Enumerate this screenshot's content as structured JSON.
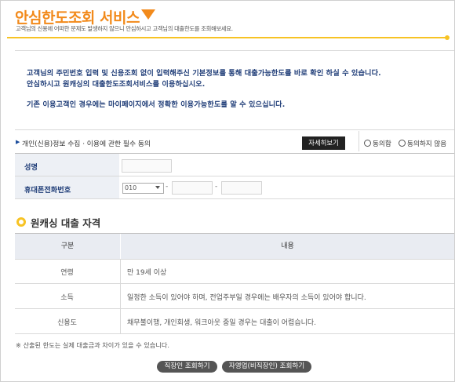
{
  "header": {
    "title": "안심한도조회 서비스",
    "subtitle": "고객님의 신용에 어떠한 문제도 발생하지 않으니 안심하시고 고객님의 대출한도를 조회해보세요."
  },
  "notice": {
    "line1": "고객님의 주민번호 입력 및 신용조회 없이 입력해주신 기본정보를 통해 대출가능한도를 바로 확인 하실 수 있습니다.",
    "line2": "안심하시고 원캐싱의 대출한도조회서비스를 이용하십시오.",
    "line3": "기존 이용고객인 경우에는 마이페이지에서 정확한 이용가능한도를 알 수 있으십니다."
  },
  "consent": {
    "label": "개인(신용)정보 수집 · 이용에 관한 필수 동의",
    "detail_button": "자세히보기",
    "agree": "동의함",
    "disagree": "동의하지 않음"
  },
  "form": {
    "name_label": "성명",
    "phone_label": "휴대폰전화번호",
    "phone_prefix": "010",
    "dash": "-"
  },
  "eligibility": {
    "title": "원캐싱 대출 자격",
    "headers": [
      "구분",
      "내용"
    ],
    "rows": [
      {
        "category": "연령",
        "content": "만 19세 이상"
      },
      {
        "category": "소득",
        "content": "일정한 소득이 있어야 하며, 전업주부일 경우에는 배우자의 소득이 있어야 합니다."
      },
      {
        "category": "신용도",
        "content": "채무불이행, 개인회생, 워크아웃 중일 경우는 대출이 어렵습니다."
      }
    ]
  },
  "footnote": "※ 산출된 한도는 실제 대출금과 차이가 있을 수 있습니다.",
  "buttons": {
    "employee": "직장인 조회하기",
    "self_employed": "자영업(비직장인) 조회하기"
  },
  "colors": {
    "accent_orange": "#f28a1b",
    "accent_yellow": "#f7c324",
    "navy_text": "#23407a",
    "label_bg": "#edf0f5"
  }
}
